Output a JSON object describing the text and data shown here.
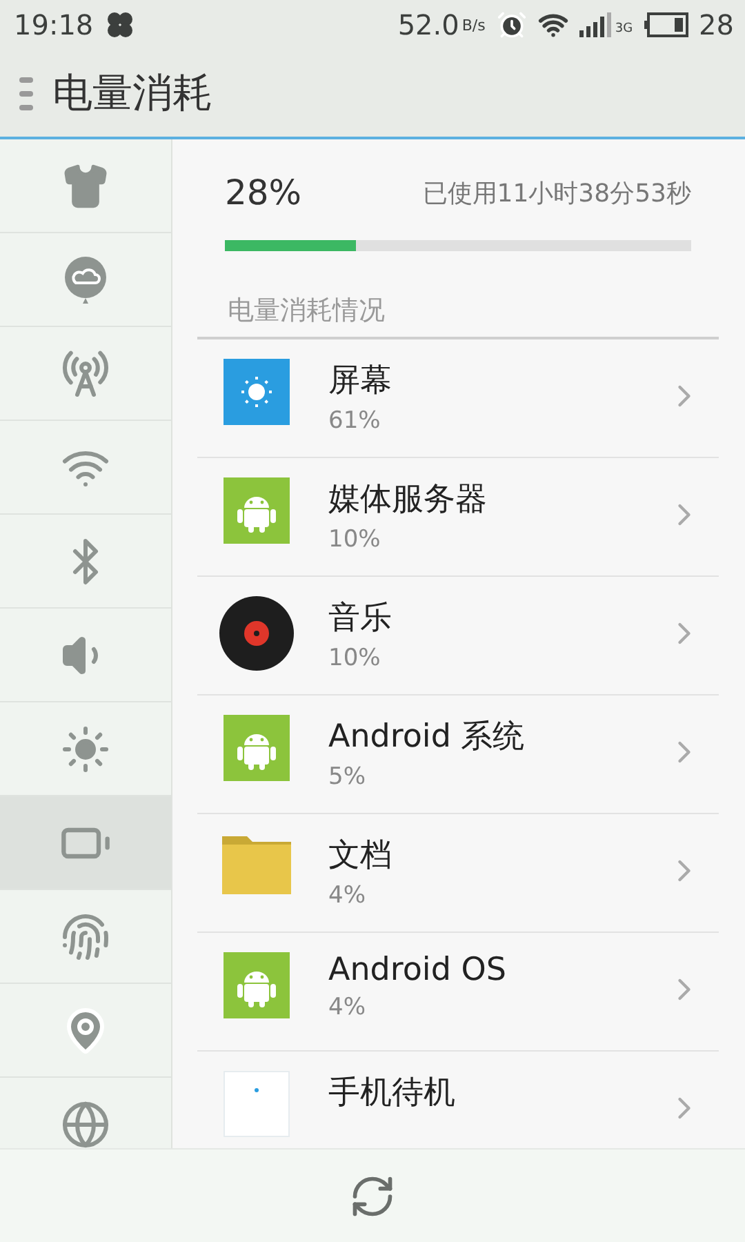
{
  "status_bar": {
    "time": "19:18",
    "speed": "52.0",
    "speed_unit": "B/s",
    "network": "3G",
    "battery": "28"
  },
  "header": {
    "title": "电量消耗"
  },
  "sidebar": {
    "items": [
      {
        "selected": false
      },
      {
        "selected": false
      },
      {
        "selected": false
      },
      {
        "selected": false
      },
      {
        "selected": false
      },
      {
        "selected": false
      },
      {
        "selected": false
      },
      {
        "selected": true
      },
      {
        "selected": false
      },
      {
        "selected": false
      },
      {
        "selected": false
      }
    ]
  },
  "summary": {
    "percent": "28%",
    "usage_time": "已使用11小时38分53秒",
    "level": 0.28
  },
  "section": {
    "title": "电量消耗情况"
  },
  "apps": [
    {
      "kind": "screen",
      "name": "屏幕",
      "percent": "61%"
    },
    {
      "kind": "android",
      "name": "媒体服务器",
      "percent": "10%"
    },
    {
      "kind": "disc",
      "name": "音乐",
      "percent": "10%"
    },
    {
      "kind": "android",
      "name": "Android 系统",
      "percent": "5%"
    },
    {
      "kind": "folder",
      "name": "文档",
      "percent": "4%"
    },
    {
      "kind": "android",
      "name": "Android OS",
      "percent": "4%"
    },
    {
      "kind": "standby",
      "name": "手机待机"
    }
  ]
}
